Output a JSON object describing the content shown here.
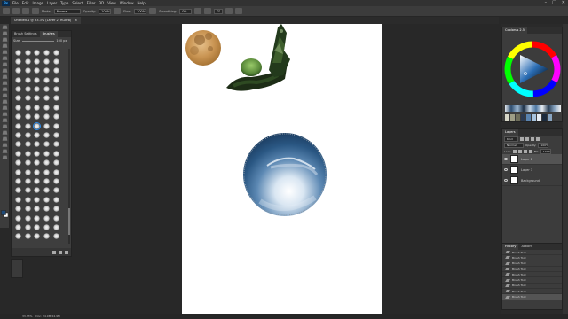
{
  "menubar": {
    "logo": "Ps",
    "items": [
      "File",
      "Edit",
      "Image",
      "Layer",
      "Type",
      "Select",
      "Filter",
      "3D",
      "View",
      "Window",
      "Help"
    ],
    "window_controls": [
      "–",
      "□",
      "✕"
    ]
  },
  "options_bar": {
    "mode_label": "Mode:",
    "mode_value": "Normal",
    "opacity_label": "Opacity:",
    "opacity_value": "100%",
    "flow_label": "Flow:",
    "flow_value": "100%",
    "smoothing_label": "Smoothing:",
    "smoothing_value": "0%",
    "angle_value": "0°"
  },
  "document": {
    "tab_title": "Untitled-1 @ 33.3% (Layer 2, RGB/8)",
    "close": "×"
  },
  "brush_panel": {
    "tabs": [
      "Brush Settings",
      "Brushes"
    ],
    "active_tab": "Brushes",
    "size_label": "Size:",
    "size_value": "100 px",
    "tip_count": 105,
    "selected_tip": 42
  },
  "color_panel": {
    "tabs": [
      "Color",
      "Swatches"
    ],
    "title": "Coolorus 2.5",
    "ring_colors": [
      "#ff0000",
      "#ff00ff",
      "#0000ff",
      "#00ffff",
      "#00ff00",
      "#ffff00",
      "#ff0000"
    ],
    "triangle_color": "#2a6db5",
    "swatch_colors": [
      "#d7d7c8",
      "#9e9e86",
      "#6e6e5a",
      "#2c3b52",
      "#5a84b0",
      "#a8c4de",
      "#e6edf4",
      "#1b2a3c",
      "#88a4c0"
    ]
  },
  "layers_panel": {
    "tabs": [
      "Layers",
      "Channels",
      "Paths"
    ],
    "active_tab": "Layers",
    "kind_label": "Kind",
    "blend_mode": "Normal",
    "opacity_label": "Opacity:",
    "opacity_value": "100%",
    "lock_label": "Lock:",
    "fill_label": "Fill:",
    "fill_value": "100%",
    "layers": [
      {
        "name": "Layer 2",
        "active": true
      },
      {
        "name": "Layer 1",
        "active": false
      },
      {
        "name": "Background",
        "active": false
      }
    ]
  },
  "history_panel": {
    "tabs": [
      "History",
      "Actions"
    ],
    "active_tab": "History",
    "items": [
      "Brush Tool",
      "Brush Tool",
      "Brush Tool",
      "Brush Tool",
      "Brush Tool",
      "Brush Tool",
      "Brush Tool",
      "Brush Tool",
      "Brush Tool"
    ]
  },
  "status_bar": {
    "zoom": "33.33%",
    "doc_info": "Doc: 24.9M/24.9M"
  },
  "colors": {
    "app_bg": "#282828",
    "panel_bg": "#3c3c3c",
    "canvas": "#ffffff",
    "accent": "#2d8ceb"
  }
}
